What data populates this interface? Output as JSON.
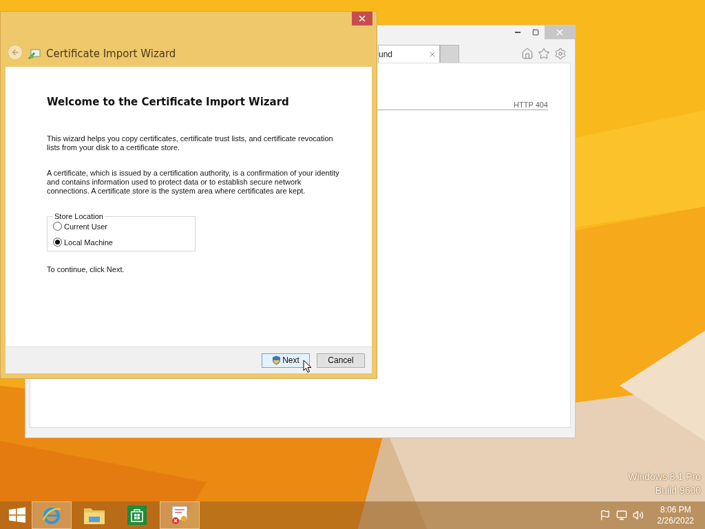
{
  "browser": {
    "tab": {
      "label": "und"
    },
    "status": "HTTP 404"
  },
  "dialog": {
    "title": "Certificate Import Wizard",
    "heading": "Welcome to the Certificate Import Wizard",
    "paragraphs": [
      "This wizard helps you copy certificates, certificate trust lists, and certificate revocation lists from your disk to a certificate store.",
      "A certificate, which is issued by a certification authority, is a confirmation of your identity and contains information used to protect data or to establish secure network connections. A certificate store is the system area where certificates are kept."
    ],
    "store_location": {
      "label": "Store Location",
      "options": [
        {
          "label": "Current User",
          "selected": false
        },
        {
          "label": "Local Machine",
          "selected": true
        }
      ]
    },
    "note": "To continue, click Next.",
    "buttons": [
      {
        "label": "Next",
        "kind": "shield",
        "focused": true
      },
      {
        "label": "Cancel",
        "kind": "plain",
        "focused": false
      }
    ]
  },
  "desktop": {
    "edition": [
      "Windows 8.1 Pro",
      "Build 9600"
    ]
  },
  "taskbar": {
    "apps": [
      {
        "kind": "browser",
        "running": true
      },
      {
        "kind": "folder",
        "running": false
      },
      {
        "kind": "store",
        "running": false
      },
      {
        "kind": "certificate",
        "running": true
      }
    ],
    "clock": {
      "time": "8:06 PM",
      "date": "2/26/2022"
    }
  }
}
